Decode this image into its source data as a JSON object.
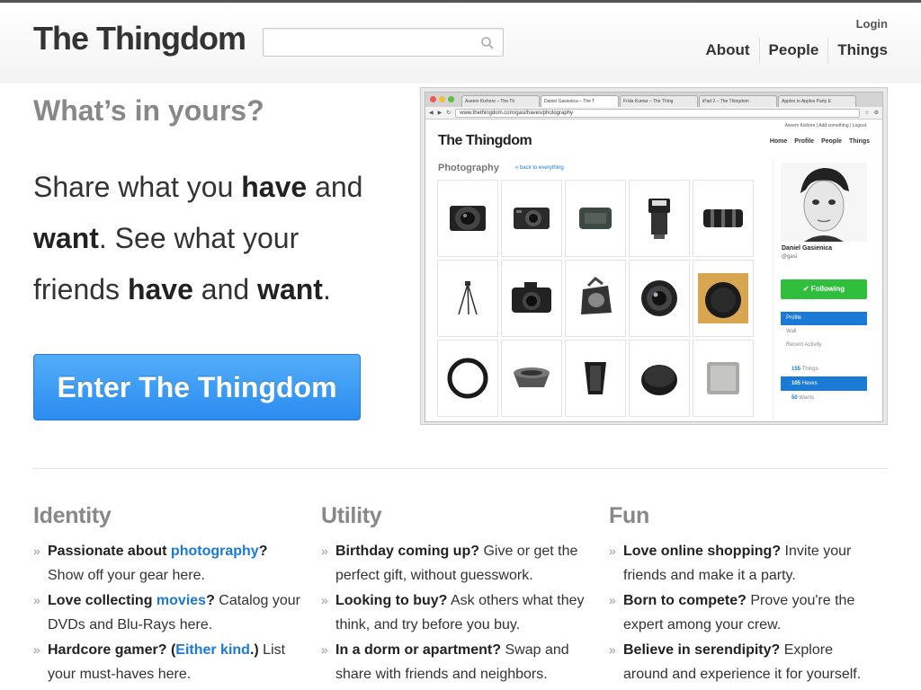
{
  "header": {
    "logo": "The Thingdom",
    "search_placeholder": "",
    "login": "Login",
    "nav": [
      "About",
      "People",
      "Things"
    ]
  },
  "hero": {
    "tagline": "What’s in yours?",
    "pitch": {
      "p1": "Share what you ",
      "have1": "have",
      "p2": " and ",
      "want1": "want",
      "p3": ". See what your friends ",
      "have2": "have",
      "p4": " and ",
      "want2": "want",
      "p5": "."
    },
    "enter_button": "Enter The Thingdom"
  },
  "screenshot": {
    "tabs": [
      "Aseem Kishore – The Th",
      "Daniel Gasienica – The T",
      "Frida Kumar – The Thing",
      "iPad 2 – The Thingdom",
      "Apples to Apples Party E"
    ],
    "url": "www.thethingdom.com/gasi/haves/photography",
    "top_links": "Aseem Kishore  |  Add something  |  Logout",
    "logo": "The Thingdom",
    "nav": [
      "Home",
      "Profile",
      "People",
      "Things"
    ],
    "title": "Photography",
    "back": "« back to everything",
    "profile_name": "Daniel Gasienica",
    "profile_handle": "@gasi",
    "follow": "✔ Following",
    "menu": [
      "Profile",
      "Wall",
      "Recent Activity"
    ],
    "counts": [
      {
        "num": "155",
        "label": "Things"
      },
      {
        "num": "105",
        "label": "Haves"
      },
      {
        "num": "50",
        "label": "Wants"
      }
    ]
  },
  "columns": [
    {
      "title": "Identity",
      "items": [
        {
          "b": "Passionate about ",
          "link": "photography",
          "b2": "?",
          "rest": " Show off your gear here."
        },
        {
          "b": "Love collecting ",
          "link": "movies",
          "b2": "?",
          "rest": " Catalog your DVDs and Blu-Rays here."
        },
        {
          "b": "Hardcore gamer? (",
          "link": "Either kind",
          "b2": ".)",
          "rest": " List your must-haves here."
        }
      ]
    },
    {
      "title": "Utility",
      "items": [
        {
          "b": "Birthday coming up?",
          "link": "",
          "b2": "",
          "rest": " Give or get the perfect gift, without guesswork."
        },
        {
          "b": "Looking to buy?",
          "link": "",
          "b2": "",
          "rest": " Ask others what they think, and try before you buy."
        },
        {
          "b": "In a dorm or apartment?",
          "link": "",
          "b2": "",
          "rest": " Swap and share with friends and neighbors."
        }
      ]
    },
    {
      "title": "Fun",
      "items": [
        {
          "b": "Love online shopping?",
          "link": "",
          "b2": "",
          "rest": " Invite your friends and make it a party."
        },
        {
          "b": "Born to compete?",
          "link": "",
          "b2": "",
          "rest": " Prove you're the expert among your crew."
        },
        {
          "b": "Believe in serendipity?",
          "link": "",
          "b2": "",
          "rest": " Explore around and experience it for yourself."
        }
      ]
    }
  ],
  "colors": {
    "accent_blue": "#1a7ad6",
    "button_blue": "#3b9cf5",
    "follow_green": "#2fbf3d"
  }
}
